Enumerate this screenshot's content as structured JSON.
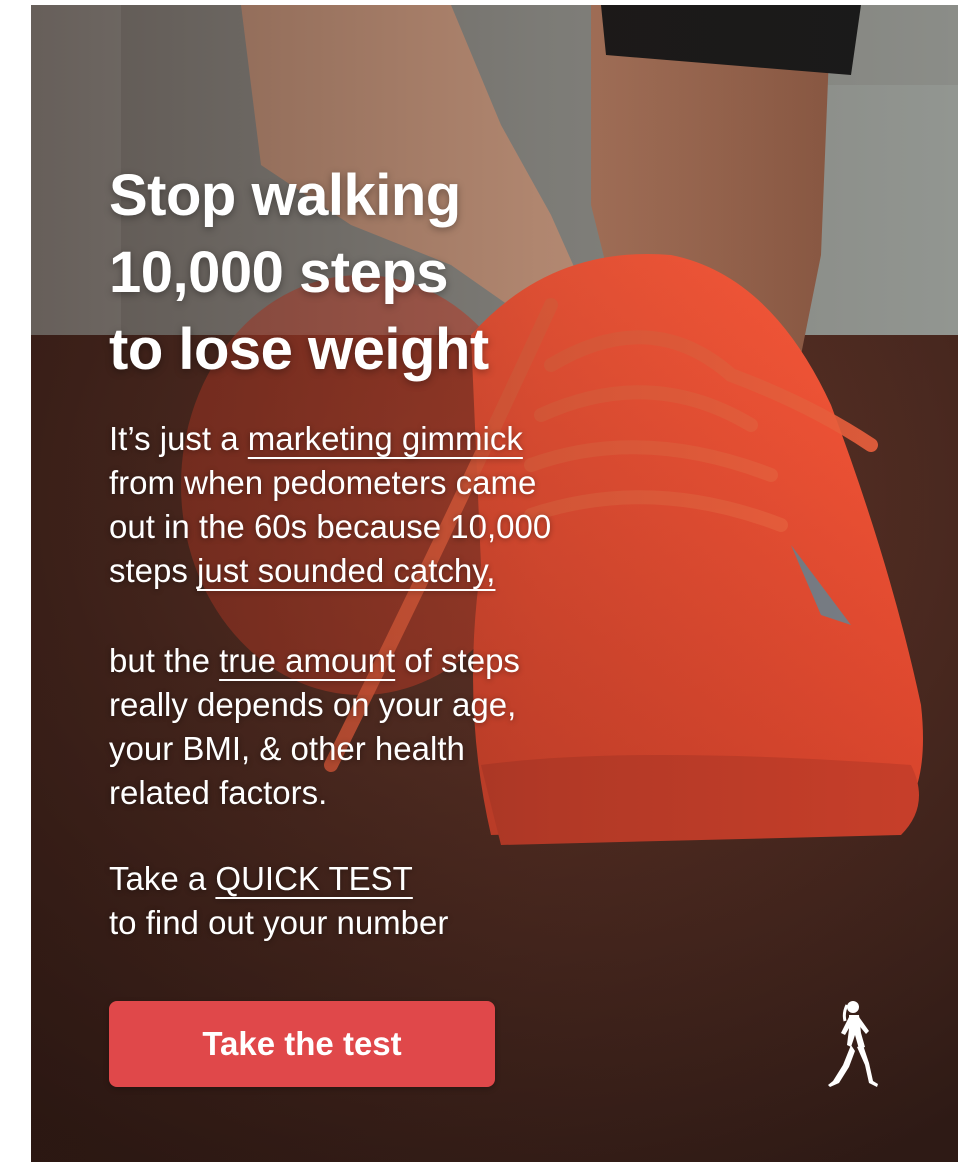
{
  "headline": {
    "line1": "Stop walking",
    "line2": "10,000 steps",
    "line3": "to lose weight"
  },
  "paragraph1": {
    "l1_pre": "It’s just a ",
    "l1_link": "marketing gimmick",
    "l2": "from when pedometers came",
    "l3": "out in the 60s because 10,000",
    "l4_pre": "steps ",
    "l4_link": "just sounded catchy,"
  },
  "paragraph2": {
    "l1_pre": "but the ",
    "l1_link": "true amount",
    "l1_post": " of steps",
    "l2": "really depends on your age,",
    "l3": "your BMI, & other health",
    "l4": "related factors."
  },
  "paragraph3": {
    "l1_pre": "Take a ",
    "l1_link": "QUICK TEST",
    "l2": "to find out your number"
  },
  "cta": {
    "label": "Take the test"
  },
  "logo": {
    "icon": "walking-woman-icon"
  },
  "colors": {
    "cta_bg": "#e0484a",
    "shoe": "#e5452f",
    "text": "#ffffff"
  }
}
